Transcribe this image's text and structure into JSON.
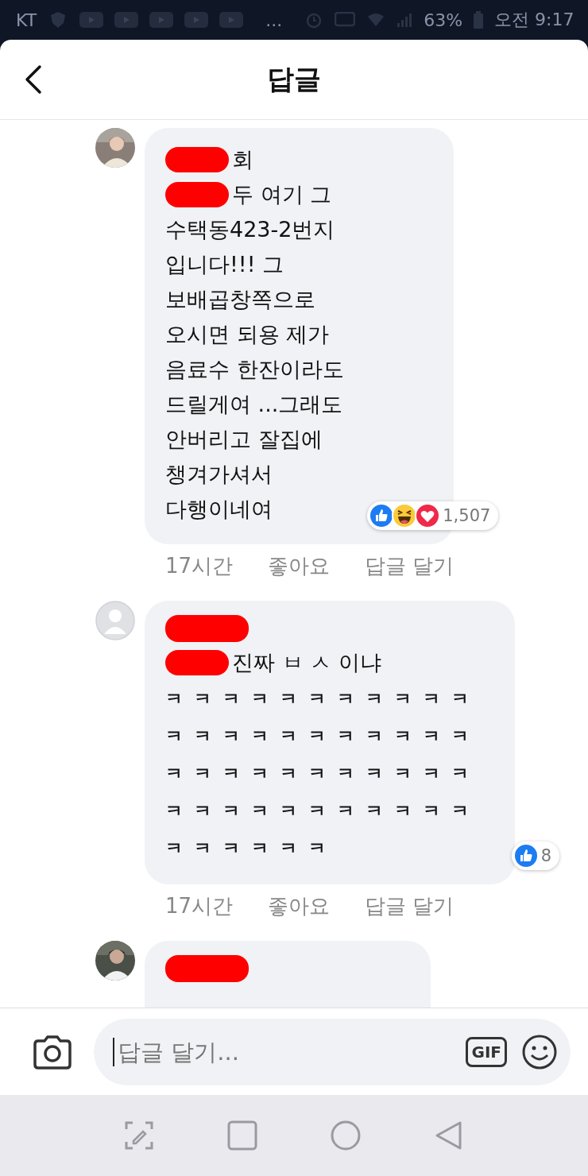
{
  "status_bar": {
    "carrier": "KT",
    "more": "...",
    "battery": "63%",
    "time": "오전 9:17"
  },
  "header": {
    "title": "답글"
  },
  "comments": [
    {
      "lines": [
        {
          "redacted": true,
          "text": "회"
        },
        {
          "redacted": true,
          "text": "두 여기 그"
        },
        {
          "redacted": false,
          "text": "수택동423-2번지"
        },
        {
          "redacted": false,
          "text": "입니다!!! 그"
        },
        {
          "redacted": false,
          "text": "보배곱창쪽으로"
        },
        {
          "redacted": false,
          "text": "오시면 되용 제가"
        },
        {
          "redacted": false,
          "text": "음료수 한잔이라도"
        },
        {
          "redacted": false,
          "text": "드릴게여 ...그래도"
        },
        {
          "redacted": false,
          "text": "안버리고 잘집에"
        },
        {
          "redacted": false,
          "text": "챙겨가셔서"
        },
        {
          "redacted": false,
          "text": "다행이네여"
        }
      ],
      "reactions": [
        {
          "kind": "like"
        },
        {
          "kind": "haha"
        },
        {
          "kind": "love"
        }
      ],
      "reaction_count": "1,507",
      "meta": {
        "time": "17시간",
        "like": "좋아요",
        "reply": "답글 달기"
      }
    },
    {
      "avatar": {
        "kind": "default"
      },
      "name_redacted": true,
      "lines": [
        {
          "redacted": true,
          "text": "진짜 ㅂ ㅅ 이냐"
        },
        {
          "redacted": false,
          "text": "ㅋㅋㅋㅋㅋㅋㅋㅋㅋㅋㅋㅋㅋㅋㅋㅋㅋㅋㅋㅋㅋㅋㅋㅋㅋㅋㅋㅋㅋㅋㅋㅋㅋㅋㅋㅋㅋㅋㅋㅋㅋㅋㅋㅋㅋㅋㅋㅋㅋㅋ"
        }
      ],
      "reactions": [
        {
          "kind": "like"
        }
      ],
      "reaction_count": "8",
      "meta": {
        "time": "17시간",
        "like": "좋아요",
        "reply": "답글 달기"
      }
    },
    {
      "name_redacted": true
    }
  ],
  "composer": {
    "placeholder": "답글 달기...",
    "gif": "GIF"
  }
}
